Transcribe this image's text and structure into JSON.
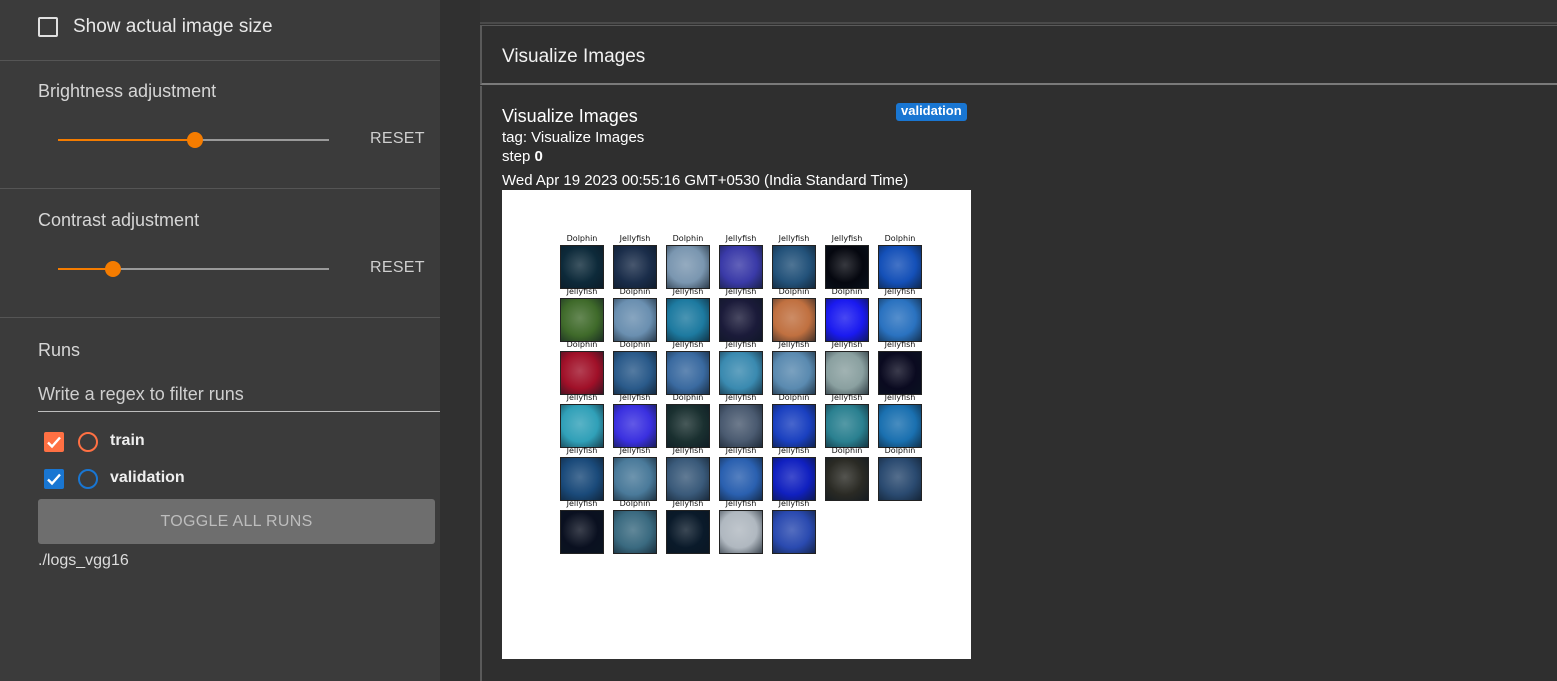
{
  "sidebar": {
    "show_actual_size": {
      "label": "Show actual image size",
      "checked": false
    },
    "brightness": {
      "title": "Brightness adjustment",
      "value": 0.5,
      "reset_label": "RESET"
    },
    "contrast": {
      "title": "Contrast adjustment",
      "value": 0.2,
      "reset_label": "RESET"
    },
    "runs": {
      "title": "Runs",
      "filter_placeholder": "Write a regex to filter runs",
      "items": [
        {
          "label": "train",
          "checked": true,
          "color": "#ff7043"
        },
        {
          "label": "validation",
          "checked": true,
          "color": "#1976d2"
        }
      ],
      "toggle_all_label": "TOGGLE ALL RUNS",
      "log_dir": "./logs_vgg16"
    }
  },
  "card": {
    "header_title": "Visualize Images",
    "image_title": "Visualize Images",
    "tag_line": "tag: Visualize Images",
    "step_label": "step",
    "step_value": "0",
    "timestamp": "Wed Apr 19 2023 00:55:16 GMT+0530 (India Standard Time)",
    "run_badge": "validation"
  },
  "image_grid": {
    "labels": [
      "Dolphin",
      "Jellyfish",
      "Dolphin",
      "Jellyfish",
      "Jellyfish",
      "Jellyfish",
      "Dolphin",
      "Jellyfish",
      "Dolphin",
      "Jellyfish",
      "Jellyfish",
      "Dolphin",
      "Dolphin",
      "Jellyfish",
      "Dolphin",
      "Dolphin",
      "Jellyfish",
      "Jellyfish",
      "Jellyfish",
      "Jellyfish",
      "Jellyfish",
      "Jellyfish",
      "Jellyfish",
      "Dolphin",
      "Jellyfish",
      "Dolphin",
      "Jellyfish",
      "Jellyfish",
      "Jellyfish",
      "Jellyfish",
      "Jellyfish",
      "Jellyfish",
      "Jellyfish",
      "Dolphin",
      "Dolphin",
      "Jellyfish",
      "Dolphin",
      "Jellyfish",
      "Jellyfish",
      "Jellyfish"
    ],
    "tile_colors": [
      "#0d2a3a",
      "#1a2d4a",
      "#7a96b0",
      "#3a3aa8",
      "#23527a",
      "#05070f",
      "#1450b8",
      "#3f6a2a",
      "#6a8fb0",
      "#1d7aa0",
      "#1b1b3a",
      "#c07040",
      "#1a1af0",
      "#2a72c0",
      "#a01028",
      "#2a5a8a",
      "#3a6aa0",
      "#3a8ab0",
      "#5a8ab0",
      "#8aa0a0",
      "#0a0a20",
      "#30a0b8",
      "#3a30e0",
      "#1a3030",
      "#4a5a70",
      "#1a40c0",
      "#2a8090",
      "#1a70b0",
      "#1a4a7a",
      "#4a7a9a",
      "#3a5a7a",
      "#2a60b0",
      "#1020c0",
      "#2a2a24",
      "#2a4a70",
      "#0a1020",
      "#3a6a80",
      "#0a1a2a",
      "#b0b8c0",
      "#2a4ab0"
    ]
  }
}
